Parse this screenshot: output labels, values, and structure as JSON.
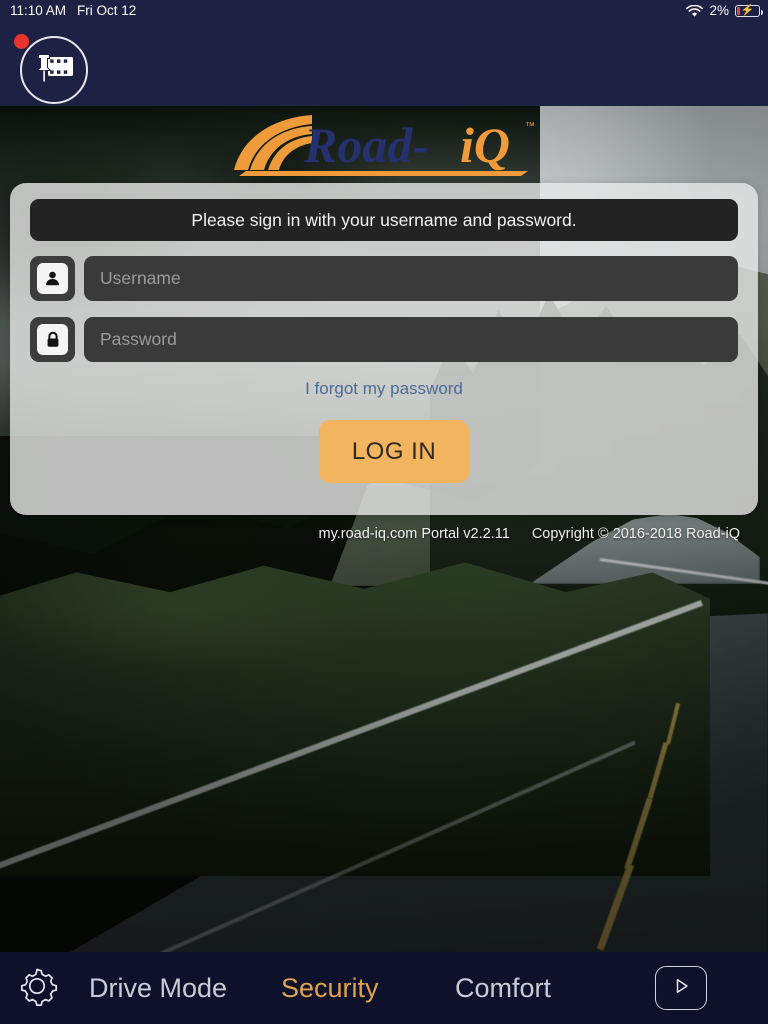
{
  "status_bar": {
    "time": "11:10 AM",
    "date": "Fri Oct 12",
    "wifi_icon": "wifi-icon",
    "battery_percent": "2%",
    "battery_icon": "battery-charging-icon",
    "background_color": "#1d2245"
  },
  "top_bar": {
    "clip_button_icon": "pin-filmstrip-icon",
    "notification_badge_color": "#e8342c",
    "background_color": "#1d2245"
  },
  "logo": {
    "word_primary": "Road-",
    "word_accent": "iQ",
    "trademark": "™",
    "navy": "#25306e",
    "orange": "#ef9b3c"
  },
  "login_panel": {
    "message": "Please sign in with your username and password.",
    "username": {
      "icon": "user-icon",
      "placeholder": "Username",
      "value": ""
    },
    "password": {
      "icon": "lock-icon",
      "placeholder": "Password",
      "value": ""
    },
    "forgot_password_link": "I forgot my password",
    "login_button": "LOG IN",
    "login_button_color": "#f2b45e",
    "link_color": "#4a6c96"
  },
  "footer": {
    "portal": "my.road-iq.com Portal v2.2.11",
    "copyright": "Copyright © 2016-2018 Road-iQ"
  },
  "bottom_nav": {
    "settings_icon": "gear-icon",
    "tabs": [
      {
        "label": "Drive Mode",
        "active": false
      },
      {
        "label": "Security",
        "active": true
      },
      {
        "label": "Comfort",
        "active": false
      }
    ],
    "play_button_icon": "play-icon",
    "active_color": "#e0a24e",
    "inactive_color": "#c9ccd6",
    "background_color": "#0d1129"
  }
}
